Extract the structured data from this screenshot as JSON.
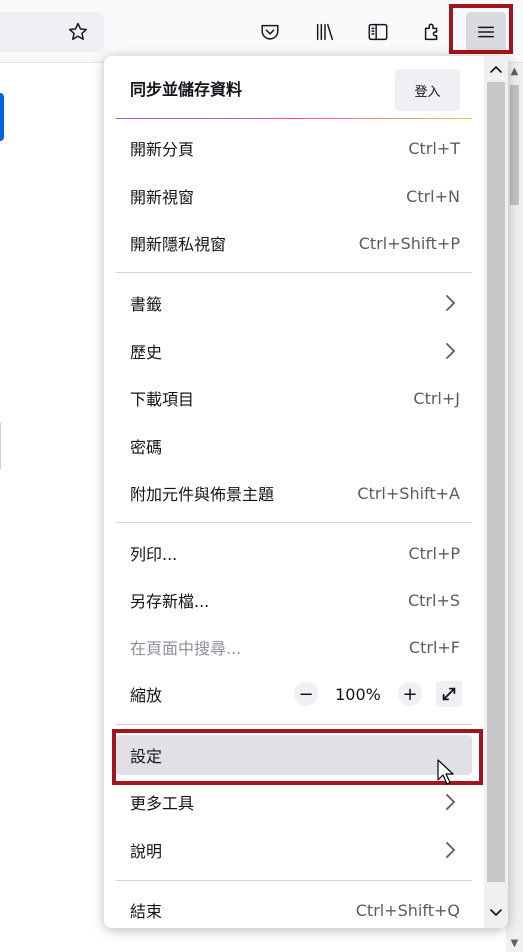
{
  "toolbar": {
    "icons": [
      "star-icon",
      "pocket-icon",
      "library-icon",
      "sidebar-icon",
      "extensions-icon",
      "hamburger-menu-icon"
    ]
  },
  "panel": {
    "sync": {
      "label": "同步並儲存資料",
      "signin": "登入"
    },
    "items": [
      {
        "label": "開新分頁",
        "shortcut": "Ctrl+T"
      },
      {
        "label": "開新視窗",
        "shortcut": "Ctrl+N"
      },
      {
        "label": "開新隱私視窗",
        "shortcut": "Ctrl+Shift+P"
      },
      {
        "label": "書籤",
        "shortcut": ""
      },
      {
        "label": "歷史",
        "shortcut": ""
      },
      {
        "label": "下載項目",
        "shortcut": "Ctrl+J"
      },
      {
        "label": "密碼",
        "shortcut": ""
      },
      {
        "label": "附加元件與佈景主題",
        "shortcut": "Ctrl+Shift+A"
      },
      {
        "label": "列印...",
        "shortcut": "Ctrl+P"
      },
      {
        "label": "另存新檔...",
        "shortcut": "Ctrl+S"
      },
      {
        "label": "在頁面中搜尋...",
        "shortcut": "Ctrl+F"
      },
      {
        "label": "縮放",
        "shortcut": ""
      },
      {
        "label": "設定",
        "shortcut": ""
      },
      {
        "label": "更多工具",
        "shortcut": ""
      },
      {
        "label": "說明",
        "shortcut": ""
      },
      {
        "label": "結束",
        "shortcut": "Ctrl+Shift+Q"
      }
    ],
    "zoom": {
      "minus": "−",
      "value": "100%",
      "plus": "+"
    }
  },
  "colors": {
    "highlight": "#a31320",
    "accent": "#0061e0"
  }
}
